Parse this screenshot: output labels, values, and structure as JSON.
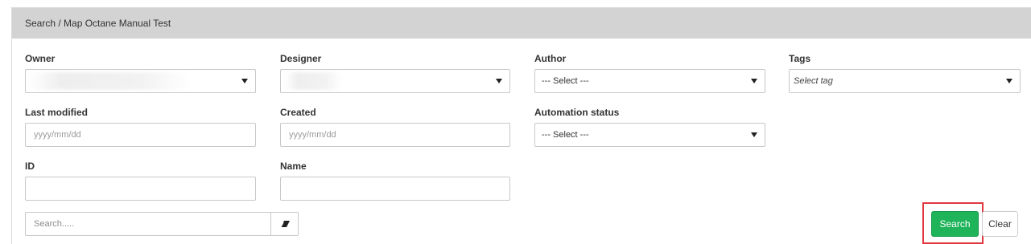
{
  "panel": {
    "title": "Search / Map Octane Manual Test"
  },
  "filters": {
    "owner": {
      "label": "Owner",
      "value": ""
    },
    "designer": {
      "label": "Designer",
      "value": ""
    },
    "author": {
      "label": "Author",
      "value": "--- Select ---"
    },
    "tags": {
      "label": "Tags",
      "value": "Select tag"
    },
    "last_modified": {
      "label": "Last modified",
      "placeholder": "yyyy/mm/dd"
    },
    "created": {
      "label": "Created",
      "placeholder": "yyyy/mm/dd"
    },
    "automation_status": {
      "label": "Automation status",
      "value": "--- Select ---"
    },
    "id": {
      "label": "ID",
      "value": ""
    },
    "name": {
      "label": "Name",
      "value": ""
    }
  },
  "search": {
    "placeholder": "Search.....",
    "eraser_icon": "eraser-icon"
  },
  "actions": {
    "search_label": "Search",
    "clear_label": "Clear",
    "search_color": "#1fb35a",
    "highlight_color": "#e0393e"
  }
}
